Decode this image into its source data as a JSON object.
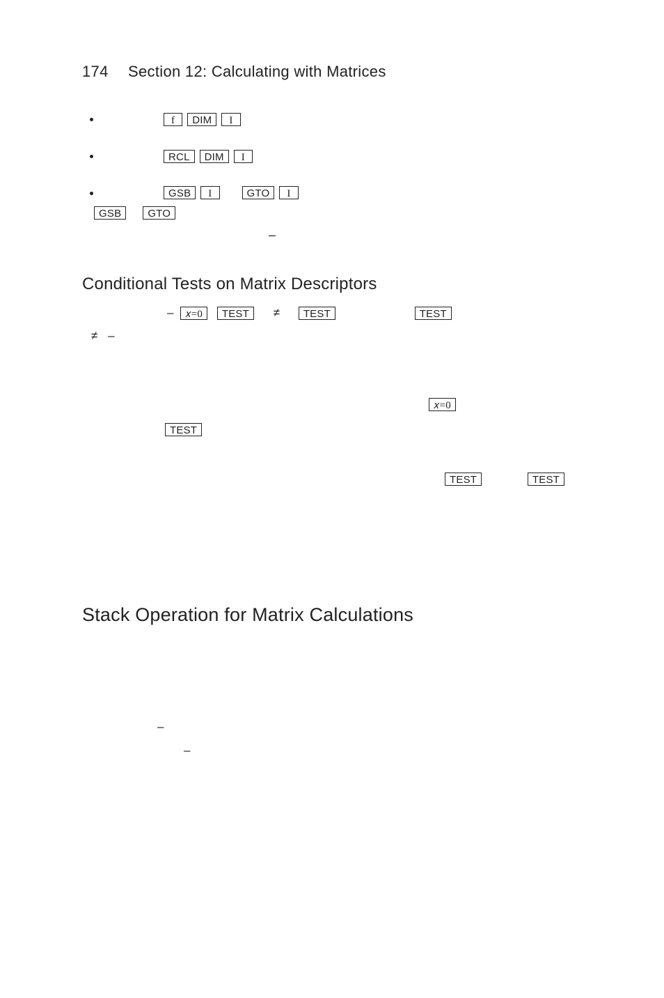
{
  "page": {
    "number": "174",
    "chapter": "Section 12: Calculating with Matrices"
  },
  "keys": {
    "f": "f",
    "DIM": "DIM",
    "I": "I",
    "RCL": "RCL",
    "GSB": "GSB",
    "GTO": "GTO",
    "x_eq_0": "𝑥=0",
    "TEST": "TEST"
  },
  "glyphs": {
    "minus": "–",
    "neq": "≠"
  },
  "headings": {
    "conditional": "Conditional Tests on Matrix Descriptors",
    "stack": "Stack Operation for Matrix Calculations"
  }
}
